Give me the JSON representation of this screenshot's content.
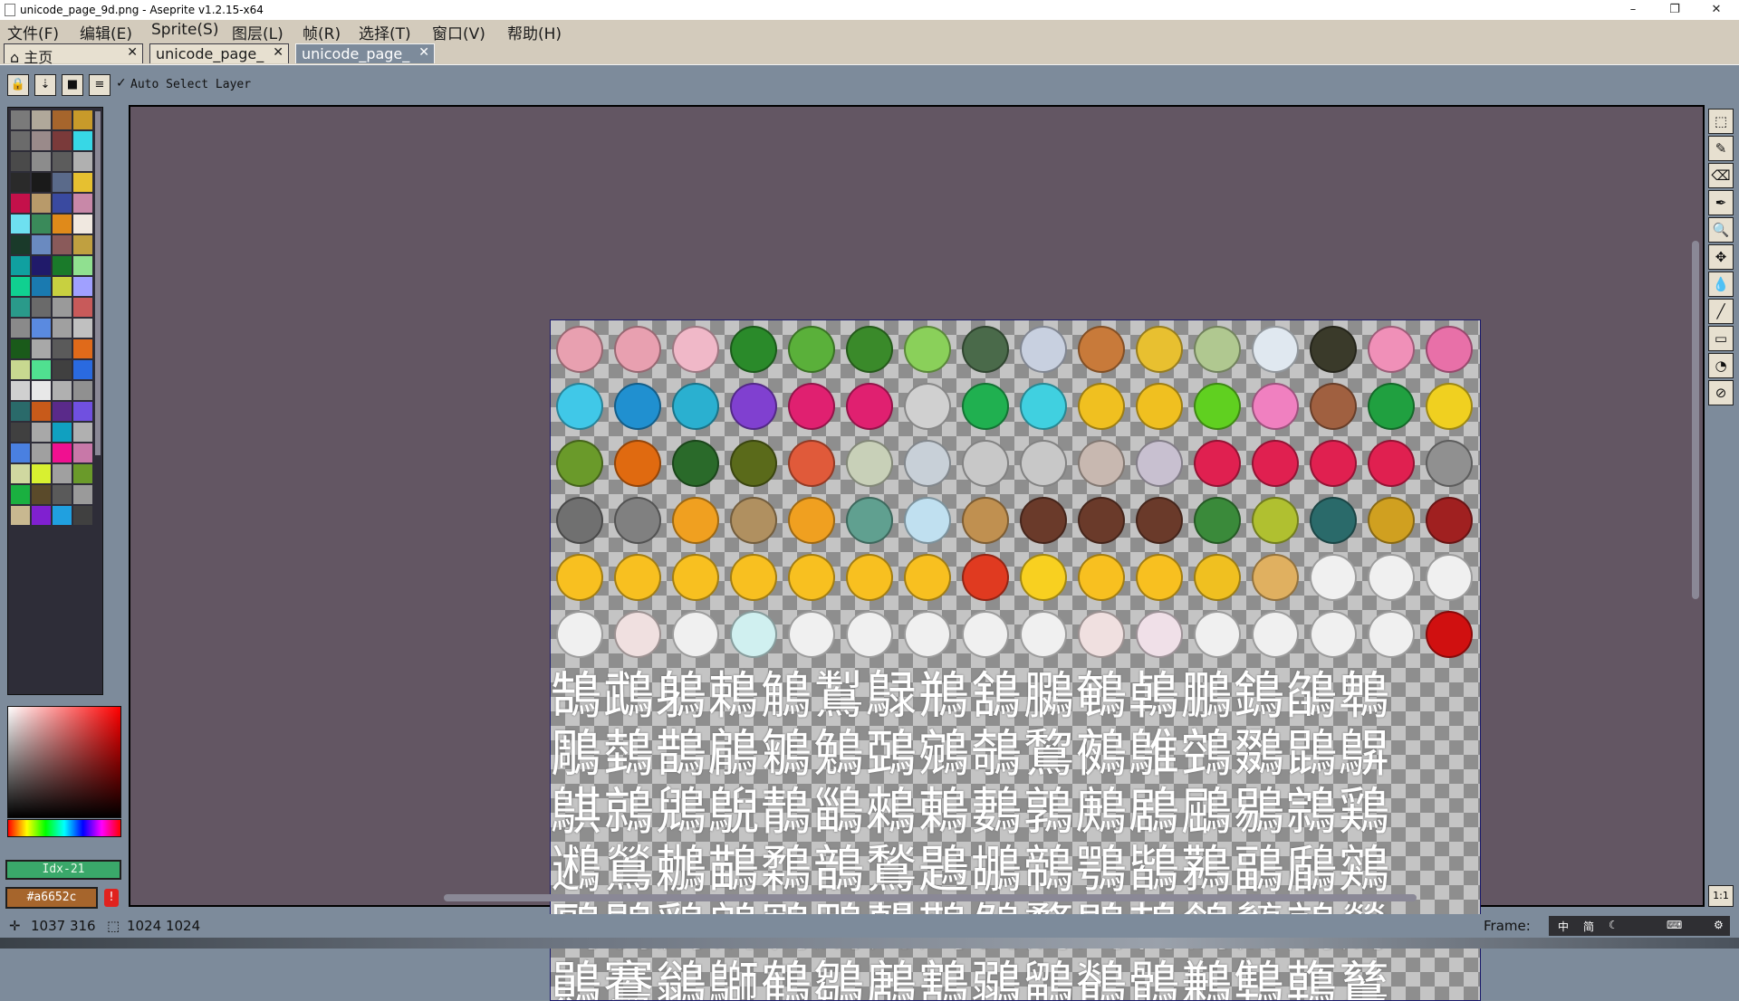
{
  "window": {
    "title": "unicode_page_9d.png - Aseprite v1.2.15-x64",
    "minimize": "–",
    "restore": "❐",
    "close": "✕"
  },
  "menu": [
    "文件(F)",
    "编辑(E)",
    "Sprite(S)",
    "图层(L)",
    "帧(R)",
    "选择(T)",
    "窗口(V)",
    "帮助(H)"
  ],
  "tabs": [
    {
      "label": "⌂ 主页",
      "close": "✕"
    },
    {
      "label": "unicode_page_",
      "close": "✕"
    },
    {
      "label": "unicode_page_",
      "close": "✕"
    }
  ],
  "context": {
    "buttons": [
      "🔒",
      "⇣",
      "■",
      "≡"
    ],
    "checkbox": "✓",
    "auto_select": "Auto Select Layer"
  },
  "palette": {
    "colors": [
      "#7a7a7a",
      "#b0a89a",
      "#a6652c",
      "#c89a2a",
      "#6b6b6b",
      "#9a8a8a",
      "#7a3a3a",
      "#37d7e6",
      "#4a4a4a",
      "#8c8c8c",
      "#5c5c5c",
      "#b0b0b0",
      "#2a2a2a",
      "#1a1a1a",
      "#5a6a8a",
      "#e6c030",
      "#c4104a",
      "#b89a6a",
      "#3a4aa0",
      "#c888a8",
      "#6ee0f0",
      "#3a8a5a",
      "#e08a1a",
      "#f0e8e0",
      "#1a3a2a",
      "#6a8ac0",
      "#8a5a5a",
      "#c0a040",
      "#10a0a0",
      "#201a6a",
      "#1a7a2a",
      "#90e090",
      "#10d090",
      "#1a7ab0",
      "#c8d040",
      "#a0a0ff",
      "#2a9a8a",
      "#6a6a6a",
      "#9a9a9a",
      "#c85a5a",
      "#8a8a8a",
      "#5a8ae0",
      "#a0a0a0",
      "#c0c0c0",
      "#1a5a1a",
      "#a8a8a8",
      "#5a5a5a",
      "#e06a1a",
      "#c8d890",
      "#50e090",
      "#404040",
      "#2a6ae0",
      "#d0d0d0",
      "#e8e8e8",
      "#b0b0b0",
      "#909090",
      "#2a6a6a",
      "#c85a1a",
      "#5a2a8a",
      "#7050e0",
      "#404040",
      "#a8a8a8",
      "#10a0c0",
      "#b0b0b0",
      "#4a80e0",
      "#a0a0a0",
      "#f01090",
      "#c878a8",
      "#d0d8a0",
      "#d8f030",
      "#a0a0a0",
      "#6a9a2a",
      "#1ab040",
      "#5a4a2a",
      "#5a5a5a",
      "#9a9a9a",
      "#c8b890",
      "#8020d0",
      "#20a0e0",
      "#404040"
    ],
    "scroll": ""
  },
  "color_bar": {
    "index_label": "Idx-21",
    "hex_label": "#a6652c",
    "warning": "!"
  },
  "tools": [
    "⬚",
    "✎",
    "⌫",
    "✒",
    "🔍",
    "✥",
    "💧",
    "╱",
    "▭",
    "◔",
    "⊘"
  ],
  "zoom_button": "1:1",
  "status": {
    "cursor_icon": "✛",
    "cursor_pos": "1037 316",
    "size_icon": "⬚",
    "size": "1024 1024",
    "frame_label": "Frame:"
  },
  "tray": {
    "items": [
      "中",
      "简",
      "☾",
      "⌨",
      "⚙"
    ]
  },
  "canvas_glyphs": [
    "鵠鵡鵢鵣鵤鵥鵦鵧鵨鵩鵪鵫鵬鵭鵮鵯",
    "鵰鵱鵲鵳鵴鵵鵶鵷鵸鵹鵺鵻鵼鵽鵾鵿",
    "鶀鶁鶂鶃鶄鶅鶆鶇鶈鶉鶊鶋鶌鶍鶎鶏",
    "鶐鶑鶒鶓鶔鶕鶖鶗鶘鶙鶚鶛鶜鶝鶞鶟",
    "鶠鶡鶢鶣鶤鶥鶦鶧鶨鶩鶪鶫鶬鶭鶮鶯",
    "鶰鶱鶲鶳鶴鶵鶶鶷鶸鶹鶺鶻鶼鶽鶾鶿"
  ],
  "sprite_colors": [
    [
      "#e8a0b0",
      "#e8a0b0",
      "#f0b8c8",
      "#2a8a2a",
      "#5ab03a",
      "#3a8a2a",
      "#8ad05a",
      "#4a6a4a",
      "#c8d0e0",
      "#c87a3a",
      "#e8c030",
      "#b0c890",
      "#e0e8f0",
      "#3a3a2a",
      "#f090b8",
      "#e870a8"
    ],
    [
      "#40c8e8",
      "#2090d0",
      "#2ab0d0",
      "#8040d0",
      "#e02070",
      "#e02070",
      "#d0d0d0",
      "#20b050",
      "#40d0e0",
      "#f0c020",
      "#f0c020",
      "#60d020",
      "#f080c0",
      "#a06040",
      "#20a040",
      "#f0d020"
    ],
    [
      "#6a9a2a",
      "#e06a10",
      "#2a6a2a",
      "#5a6a1a",
      "#e05a3a",
      "#c8d0b8",
      "#c8d0d8",
      "#c8c8c8",
      "#c8c8c8",
      "#c8b8b0",
      "#c8c0d0",
      "#e02050",
      "#e02050",
      "#e02050",
      "#e02050",
      "#909090"
    ],
    [
      "#707070",
      "#808080",
      "#f0a020",
      "#b09060",
      "#f0a020",
      "#60a090",
      "#c0e0f0",
      "#c09050",
      "#6a3a2a",
      "#6a3a2a",
      "#6a3a2a",
      "#3a8a3a",
      "#b0c030",
      "#2a6a6a",
      "#d0a020",
      "#a02020"
    ],
    [
      "#f8c020",
      "#f8c020",
      "#f8c020",
      "#f8c020",
      "#f8c020",
      "#f8c020",
      "#f8c020",
      "#e03a20",
      "#f8d020",
      "#f8c020",
      "#f8c020",
      "#f0c020",
      "#e0b060",
      "#f0f0f0",
      "#f0f0f0",
      "#f0f0f0"
    ],
    [
      "#f0f0f0",
      "#f0e0e0",
      "#f0f0f0",
      "#d0f0f0",
      "#f0f0f0",
      "#f0f0f0",
      "#f0f0f0",
      "#f0f0f0",
      "#f0f0f0",
      "#f0e0e0",
      "#f0e0e8",
      "#f0f0f0",
      "#f0f0f0",
      "#f0f0f0",
      "#f0f0f0",
      "#d01010"
    ]
  ]
}
